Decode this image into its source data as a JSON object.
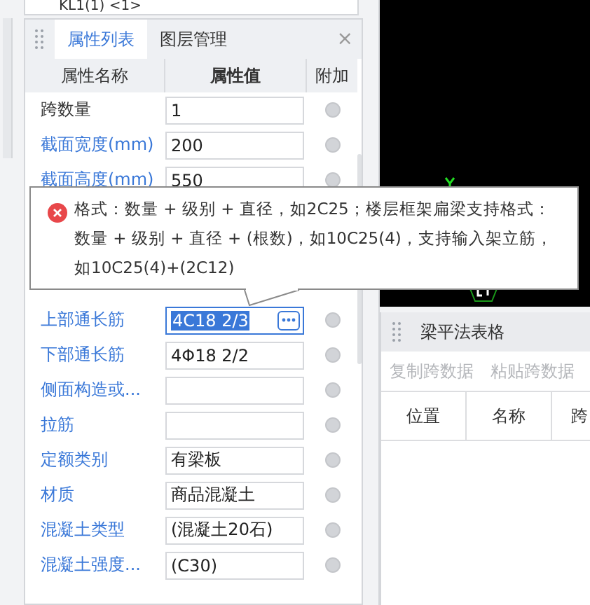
{
  "top_strip": {
    "text": "KL1(1) <1>"
  },
  "property_panel": {
    "tabs": [
      {
        "label": "属性列表",
        "selected": true
      },
      {
        "label": "图层管理",
        "selected": false
      }
    ],
    "close": "×",
    "columns": [
      "属性名称",
      "属性值",
      "附加"
    ],
    "rows": [
      {
        "name": "跨数量",
        "linked": false,
        "value": "1",
        "selected": false,
        "checked": false
      },
      {
        "name": "截面宽度(mm)",
        "linked": true,
        "value": "200",
        "selected": false,
        "checked": false
      },
      {
        "name": "截面高度(mm)",
        "linked": true,
        "value": "550",
        "selected": false,
        "checked": false
      },
      {
        "name": "上部通长筋",
        "linked": true,
        "value": "4C18 2/3",
        "selected": true,
        "checked": false
      },
      {
        "name": "下部通长筋",
        "linked": true,
        "value": "4Φ18 2/2",
        "selected": false,
        "checked": false
      },
      {
        "name": "侧面构造或...",
        "linked": true,
        "value": "",
        "selected": false,
        "checked": false
      },
      {
        "name": "拉筋",
        "linked": true,
        "value": "",
        "selected": false,
        "checked": false
      },
      {
        "name": "定额类别",
        "linked": true,
        "value": "有梁板",
        "selected": false,
        "checked": false
      },
      {
        "name": "材质",
        "linked": true,
        "value": "商品混凝土",
        "selected": false,
        "checked": false
      },
      {
        "name": "混凝土类型",
        "linked": true,
        "value": "(混凝土20石)",
        "selected": false,
        "checked": false
      },
      {
        "name": "混凝土强度...",
        "linked": true,
        "value": "(C30)",
        "selected": false,
        "checked": false
      }
    ]
  },
  "tooltip": {
    "text": "格式：数量 + 级别 + 直径，如2C25；楼层框架扁梁支持格式：数量 + 级别 + 直径 + (根数)，如10C25(4)，支持输入架立筋，如10C25(4)+(2C12)"
  },
  "table_panel": {
    "title": "梁平法表格",
    "toolbar": [
      {
        "label": "复制跨数据",
        "disabled": true
      },
      {
        "label": "粘贴跨数据",
        "disabled": true
      }
    ],
    "columns": [
      "位置",
      "名称",
      "跨"
    ]
  }
}
